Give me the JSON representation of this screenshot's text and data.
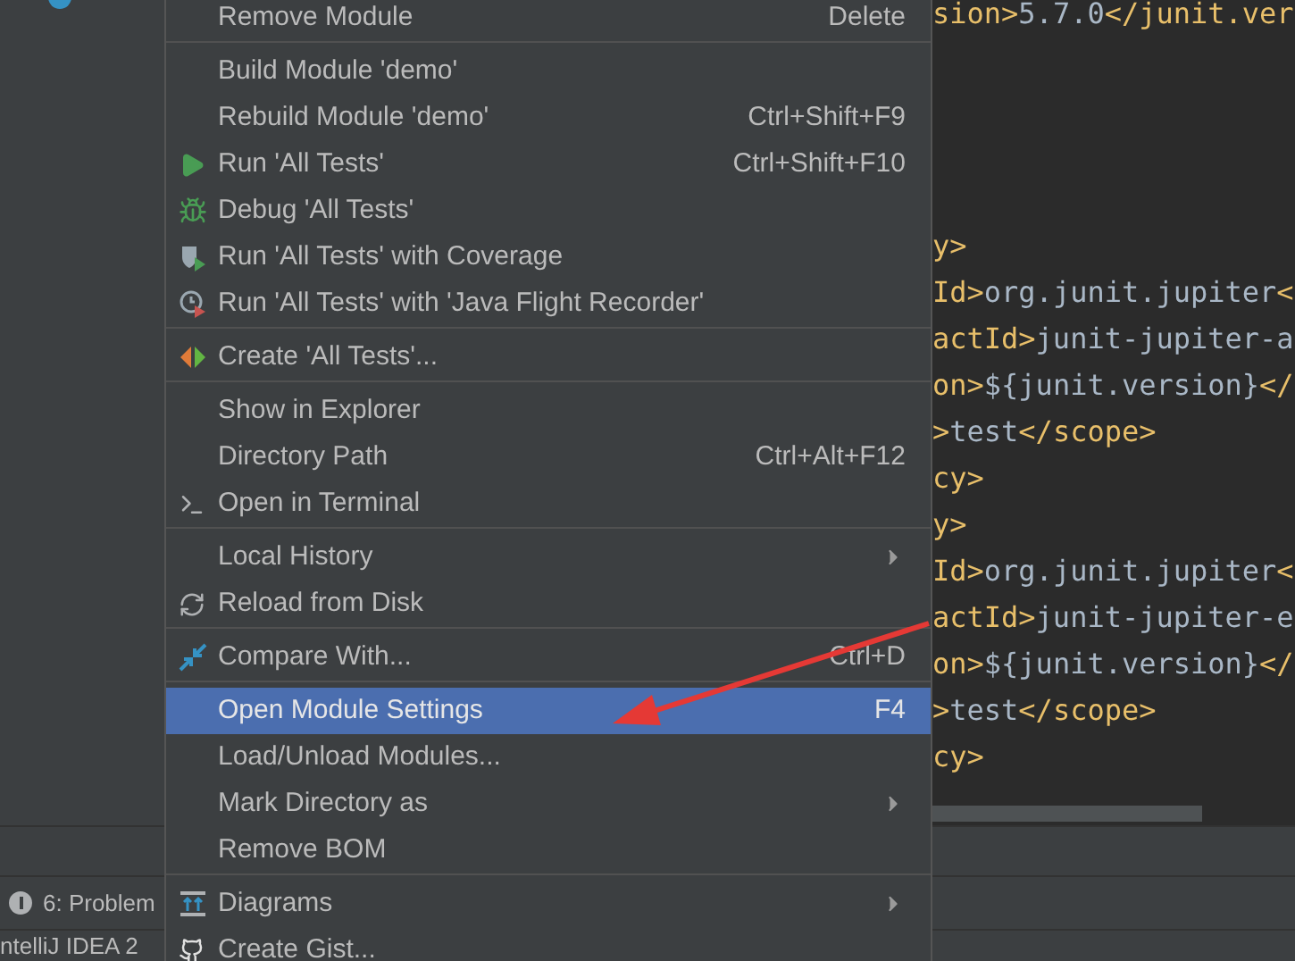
{
  "context_menu": {
    "groups": [
      [
        {
          "label": "Remove Module",
          "shortcut": "Delete",
          "submenu": false,
          "selected": false
        }
      ],
      [
        {
          "label": "Build Module 'demo'",
          "submenu": false,
          "selected": false
        },
        {
          "label": "Rebuild Module 'demo'",
          "shortcut": "Ctrl+Shift+F9",
          "submenu": false,
          "selected": false
        },
        {
          "label": "Run 'All Tests'",
          "shortcut": "Ctrl+Shift+F10",
          "submenu": false,
          "selected": false
        },
        {
          "label": "Debug 'All Tests'",
          "submenu": false,
          "selected": false
        },
        {
          "label": "Run 'All Tests' with Coverage",
          "submenu": false,
          "selected": false
        },
        {
          "label": "Run 'All Tests' with 'Java Flight Recorder'",
          "submenu": false,
          "selected": false
        }
      ],
      [
        {
          "label": "Create 'All Tests'...",
          "submenu": false,
          "selected": false
        }
      ],
      [
        {
          "label": "Show in Explorer",
          "submenu": false,
          "selected": false
        },
        {
          "label": "Directory Path",
          "shortcut": "Ctrl+Alt+F12",
          "submenu": false,
          "selected": false
        },
        {
          "label": "Open in Terminal",
          "submenu": false,
          "selected": false
        }
      ],
      [
        {
          "label": "Local History",
          "submenu": true,
          "selected": false
        },
        {
          "label": "Reload from Disk",
          "submenu": false,
          "selected": false
        }
      ],
      [
        {
          "label": "Compare With...",
          "shortcut": "Ctrl+D",
          "submenu": false,
          "selected": false
        }
      ],
      [
        {
          "label": "Open Module Settings",
          "shortcut": "F4",
          "submenu": false,
          "selected": true
        },
        {
          "label": "Load/Unload Modules...",
          "submenu": false,
          "selected": false
        },
        {
          "label": "Mark Directory as",
          "submenu": true,
          "selected": false
        },
        {
          "label": "Remove BOM",
          "submenu": false,
          "selected": false
        }
      ],
      [
        {
          "label": "Diagrams",
          "submenu": true,
          "selected": false
        },
        {
          "label": "Create Gist...",
          "submenu": false,
          "selected": false
        }
      ]
    ]
  },
  "editor": {
    "first_line": [
      {
        "kind": "tag",
        "text": "sion>"
      },
      {
        "kind": "text",
        "text": "5.7.0"
      },
      {
        "kind": "tag",
        "text": "</junit.ver"
      }
    ],
    "lines": [
      [
        {
          "kind": "tag",
          "text": "y>"
        }
      ],
      [
        {
          "kind": "tag",
          "text": "Id>"
        },
        {
          "kind": "text",
          "text": "org.junit.jupiter"
        },
        {
          "kind": "tag",
          "text": "<"
        }
      ],
      [
        {
          "kind": "tag",
          "text": "actId>"
        },
        {
          "kind": "text",
          "text": "junit-jupiter-a"
        }
      ],
      [
        {
          "kind": "tag",
          "text": "on>"
        },
        {
          "kind": "text",
          "text": "${junit.version}"
        },
        {
          "kind": "tag",
          "text": "</"
        }
      ],
      [
        {
          "kind": "tag",
          "text": ">"
        },
        {
          "kind": "text",
          "text": "test"
        },
        {
          "kind": "tag",
          "text": "</scope>"
        }
      ],
      [
        {
          "kind": "tag",
          "text": "cy>"
        }
      ],
      [
        {
          "kind": "tag",
          "text": "y>"
        }
      ],
      [
        {
          "kind": "tag",
          "text": "Id>"
        },
        {
          "kind": "text",
          "text": "org.junit.jupiter"
        },
        {
          "kind": "tag",
          "text": "<"
        }
      ],
      [
        {
          "kind": "tag",
          "text": "actId>"
        },
        {
          "kind": "text",
          "text": "junit-jupiter-e"
        }
      ],
      [
        {
          "kind": "tag",
          "text": "on>"
        },
        {
          "kind": "text",
          "text": "${junit.version}"
        },
        {
          "kind": "tag",
          "text": "</"
        }
      ],
      [
        {
          "kind": "tag",
          "text": ">"
        },
        {
          "kind": "text",
          "text": "test"
        },
        {
          "kind": "tag",
          "text": "</scope>"
        }
      ],
      [
        {
          "kind": "tag",
          "text": "cy>"
        }
      ]
    ]
  },
  "tool_tab": {
    "label": "6: Problem"
  },
  "status_bar": {
    "text": "ntelliJ IDEA 2"
  }
}
